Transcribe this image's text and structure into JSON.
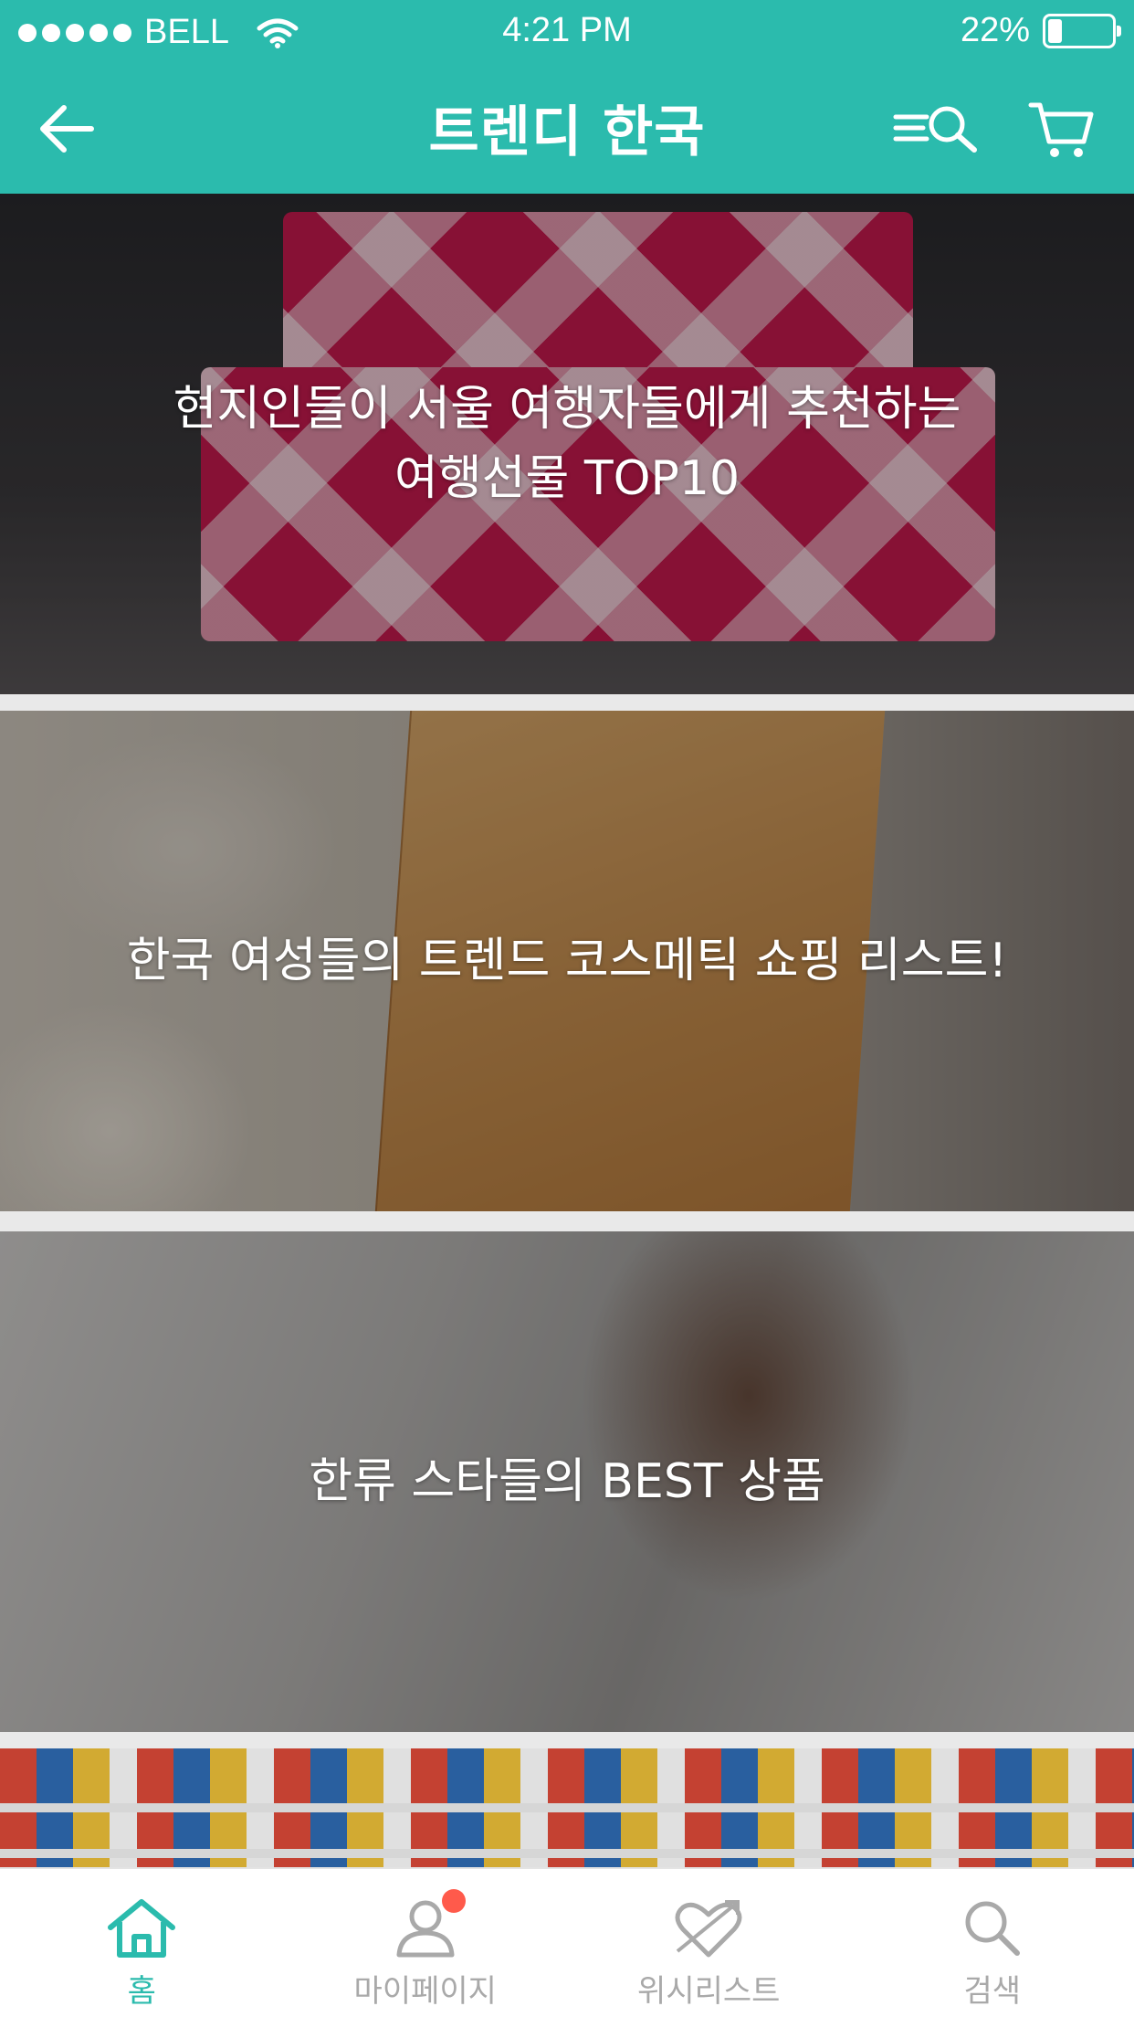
{
  "status_bar": {
    "carrier": "BELL",
    "time": "4:21 PM",
    "battery_percent": "22%",
    "battery_level": 0.22
  },
  "nav": {
    "title": "트렌디 한국",
    "icons": [
      "back-arrow-icon",
      "search-filter-icon",
      "cart-icon"
    ]
  },
  "banners": [
    {
      "title": "현지인들이 서울 여행자들에게 추천하는\n여행선물 TOP10"
    },
    {
      "title": "한국 여성들의 트렌드 코스메틱 쇼핑 리스트!"
    },
    {
      "title": "한류 스타들의 BEST 상품"
    },
    {
      "title": ""
    }
  ],
  "tabs": [
    {
      "label": "홈",
      "icon": "home-icon",
      "active": true
    },
    {
      "label": "마이페이지",
      "icon": "user-icon",
      "badge": true
    },
    {
      "label": "위시리스트",
      "icon": "heart-arrow-icon"
    },
    {
      "label": "검색",
      "icon": "search-icon"
    }
  ],
  "colors": {
    "primary": "#2bbbad",
    "badge": "#ff5a4b",
    "tab_inactive": "#a9a9a9"
  }
}
